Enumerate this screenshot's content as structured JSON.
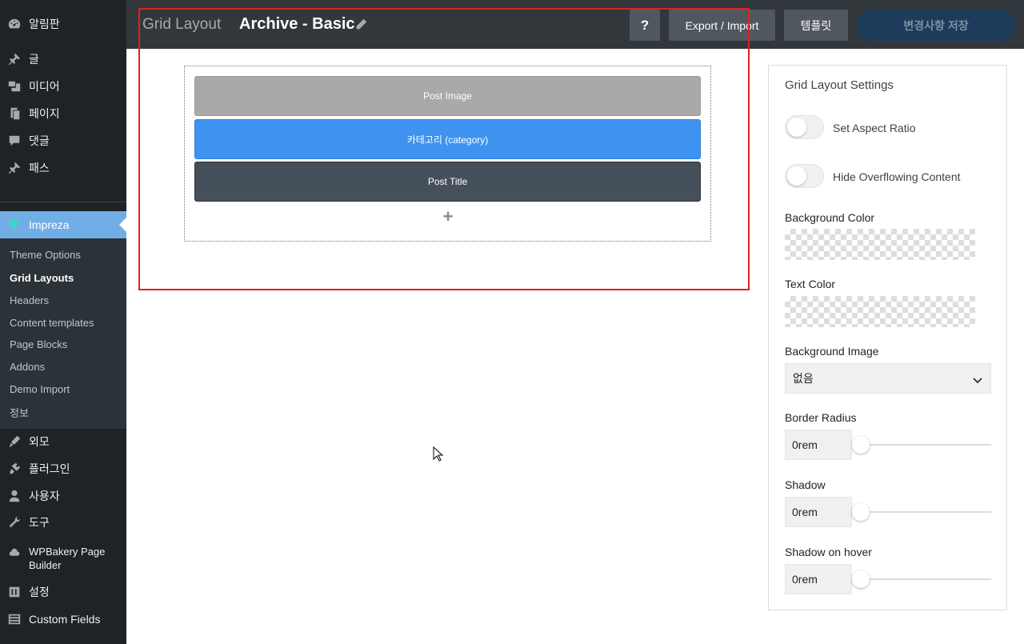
{
  "sidebar": {
    "items": [
      {
        "label": "알림판",
        "icon": "dashboard-icon"
      },
      {
        "label": "글",
        "icon": "pin-icon"
      },
      {
        "label": "미디어",
        "icon": "media-icon"
      },
      {
        "label": "페이지",
        "icon": "pages-icon"
      },
      {
        "label": "댓글",
        "icon": "comments-icon"
      },
      {
        "label": "패스",
        "icon": "pin-icon"
      },
      {
        "label": "Impreza",
        "icon": "impreza-icon"
      },
      {
        "label": "외모",
        "icon": "appearance-icon"
      },
      {
        "label": "플러그인",
        "icon": "plugins-icon"
      },
      {
        "label": "사용자",
        "icon": "users-icon"
      },
      {
        "label": "도구",
        "icon": "tools-icon"
      },
      {
        "label": "WPBakery Page Builder",
        "icon": "wpbakery-icon"
      },
      {
        "label": "설정",
        "icon": "settings-icon"
      },
      {
        "label": "Custom Fields",
        "icon": "custom-fields-icon"
      }
    ],
    "submenu": [
      "Theme Options",
      "Grid Layouts",
      "Headers",
      "Content templates",
      "Page Blocks",
      "Addons",
      "Demo Import",
      "정보"
    ]
  },
  "topbar": {
    "prefix": "Grid Layout",
    "title": "Archive - Basic",
    "help_label": "?",
    "export_label": "Export / Import",
    "templates_label": "템플릿",
    "save_label": "변경사항 저장"
  },
  "canvas": {
    "elements": [
      "Post Image",
      "카테고리 (category)",
      "Post Title"
    ],
    "add_label": "+"
  },
  "panel": {
    "heading": "Grid Layout Settings",
    "aspect_ratio_label": "Set Aspect Ratio",
    "aspect_ratio_on": false,
    "hide_overflow_label": "Hide Overflowing Content",
    "hide_overflow_on": false,
    "bg_color_label": "Background Color",
    "text_color_label": "Text Color",
    "bg_image_label": "Background Image",
    "bg_image_value": "없음",
    "border_radius_label": "Border Radius",
    "border_radius_value": "0rem",
    "shadow_label": "Shadow",
    "shadow_value": "0rem",
    "shadow_hover_label": "Shadow on hover",
    "shadow_hover_value": "0rem"
  }
}
